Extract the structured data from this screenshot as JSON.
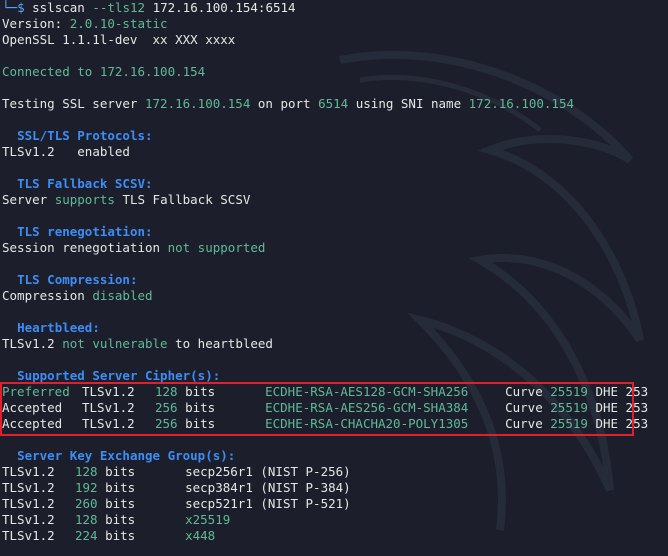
{
  "prompt": {
    "corner": "└─",
    "dollar": "$",
    "command": "sslscan",
    "flag": "--tls12",
    "target": "172.16.100.154:6514"
  },
  "header": {
    "version_label": "Version:",
    "version_value": "2.0.10-static",
    "openssl_line": "OpenSSL 1.1.1l-dev  xx XXX xxxx"
  },
  "connected": "Connected to 172.16.100.154",
  "testing": {
    "prefix": "Testing SSL server",
    "server": "172.16.100.154",
    "on_port": "on port",
    "port": "6514",
    "using_sni": "using SNI name",
    "sni": "172.16.100.154"
  },
  "sections": {
    "protocols": {
      "heading": "SSL/TLS Protocols:",
      "proto": "TLSv1.2",
      "status": "enabled"
    },
    "fallback": {
      "heading": "TLS Fallback SCSV:",
      "pre": "Server",
      "status": "supports",
      "post": "TLS Fallback SCSV"
    },
    "renegotiation": {
      "heading": "TLS renegotiation:",
      "pre": "Session renegotiation",
      "status": "not supported"
    },
    "compression": {
      "heading": "TLS Compression:",
      "pre": "Compression",
      "status": "disabled"
    },
    "heartbleed": {
      "heading": "Heartbleed:",
      "proto": "TLSv1.2",
      "status": "not vulnerable",
      "post": "to heartbleed"
    }
  },
  "ciphers": {
    "heading": "Supported Server Cipher(s):",
    "rows": [
      {
        "state": "Preferred",
        "proto": "TLSv1.2",
        "bits": "128",
        "unit": "bits",
        "cipher": "ECDHE-RSA-AES128-GCM-SHA256",
        "curve_label": "Curve",
        "curve": "25519",
        "dhe": "DHE 253"
      },
      {
        "state": "Accepted",
        "proto": "TLSv1.2",
        "bits": "256",
        "unit": "bits",
        "cipher": "ECDHE-RSA-AES256-GCM-SHA384",
        "curve_label": "Curve",
        "curve": "25519",
        "dhe": "DHE 253"
      },
      {
        "state": "Accepted",
        "proto": "TLSv1.2",
        "bits": "256",
        "unit": "bits",
        "cipher": "ECDHE-RSA-CHACHA20-POLY1305",
        "curve_label": "Curve",
        "curve": "25519",
        "dhe": "DHE 253"
      }
    ]
  },
  "key_exchange": {
    "heading": "Server Key Exchange Group(s):",
    "rows": [
      {
        "proto": "TLSv1.2",
        "bits": "128",
        "unit": "bits",
        "group": "secp256r1 (NIST P-256)"
      },
      {
        "proto": "TLSv1.2",
        "bits": "192",
        "unit": "bits",
        "group": "secp384r1 (NIST P-384)"
      },
      {
        "proto": "TLSv1.2",
        "bits": "260",
        "unit": "bits",
        "group": "secp521r1 (NIST P-521)"
      },
      {
        "proto": "TLSv1.2",
        "bits": "128",
        "unit": "bits",
        "group": "x25519"
      },
      {
        "proto": "TLSv1.2",
        "bits": "224",
        "unit": "bits",
        "group": "x448"
      }
    ]
  },
  "colors": {
    "background": "#1c1f2b",
    "text": "#e6e6e6",
    "highlight_green": "#5fb99a",
    "heading_blue": "#3d8df5",
    "annotation_red": "#e0202a"
  }
}
